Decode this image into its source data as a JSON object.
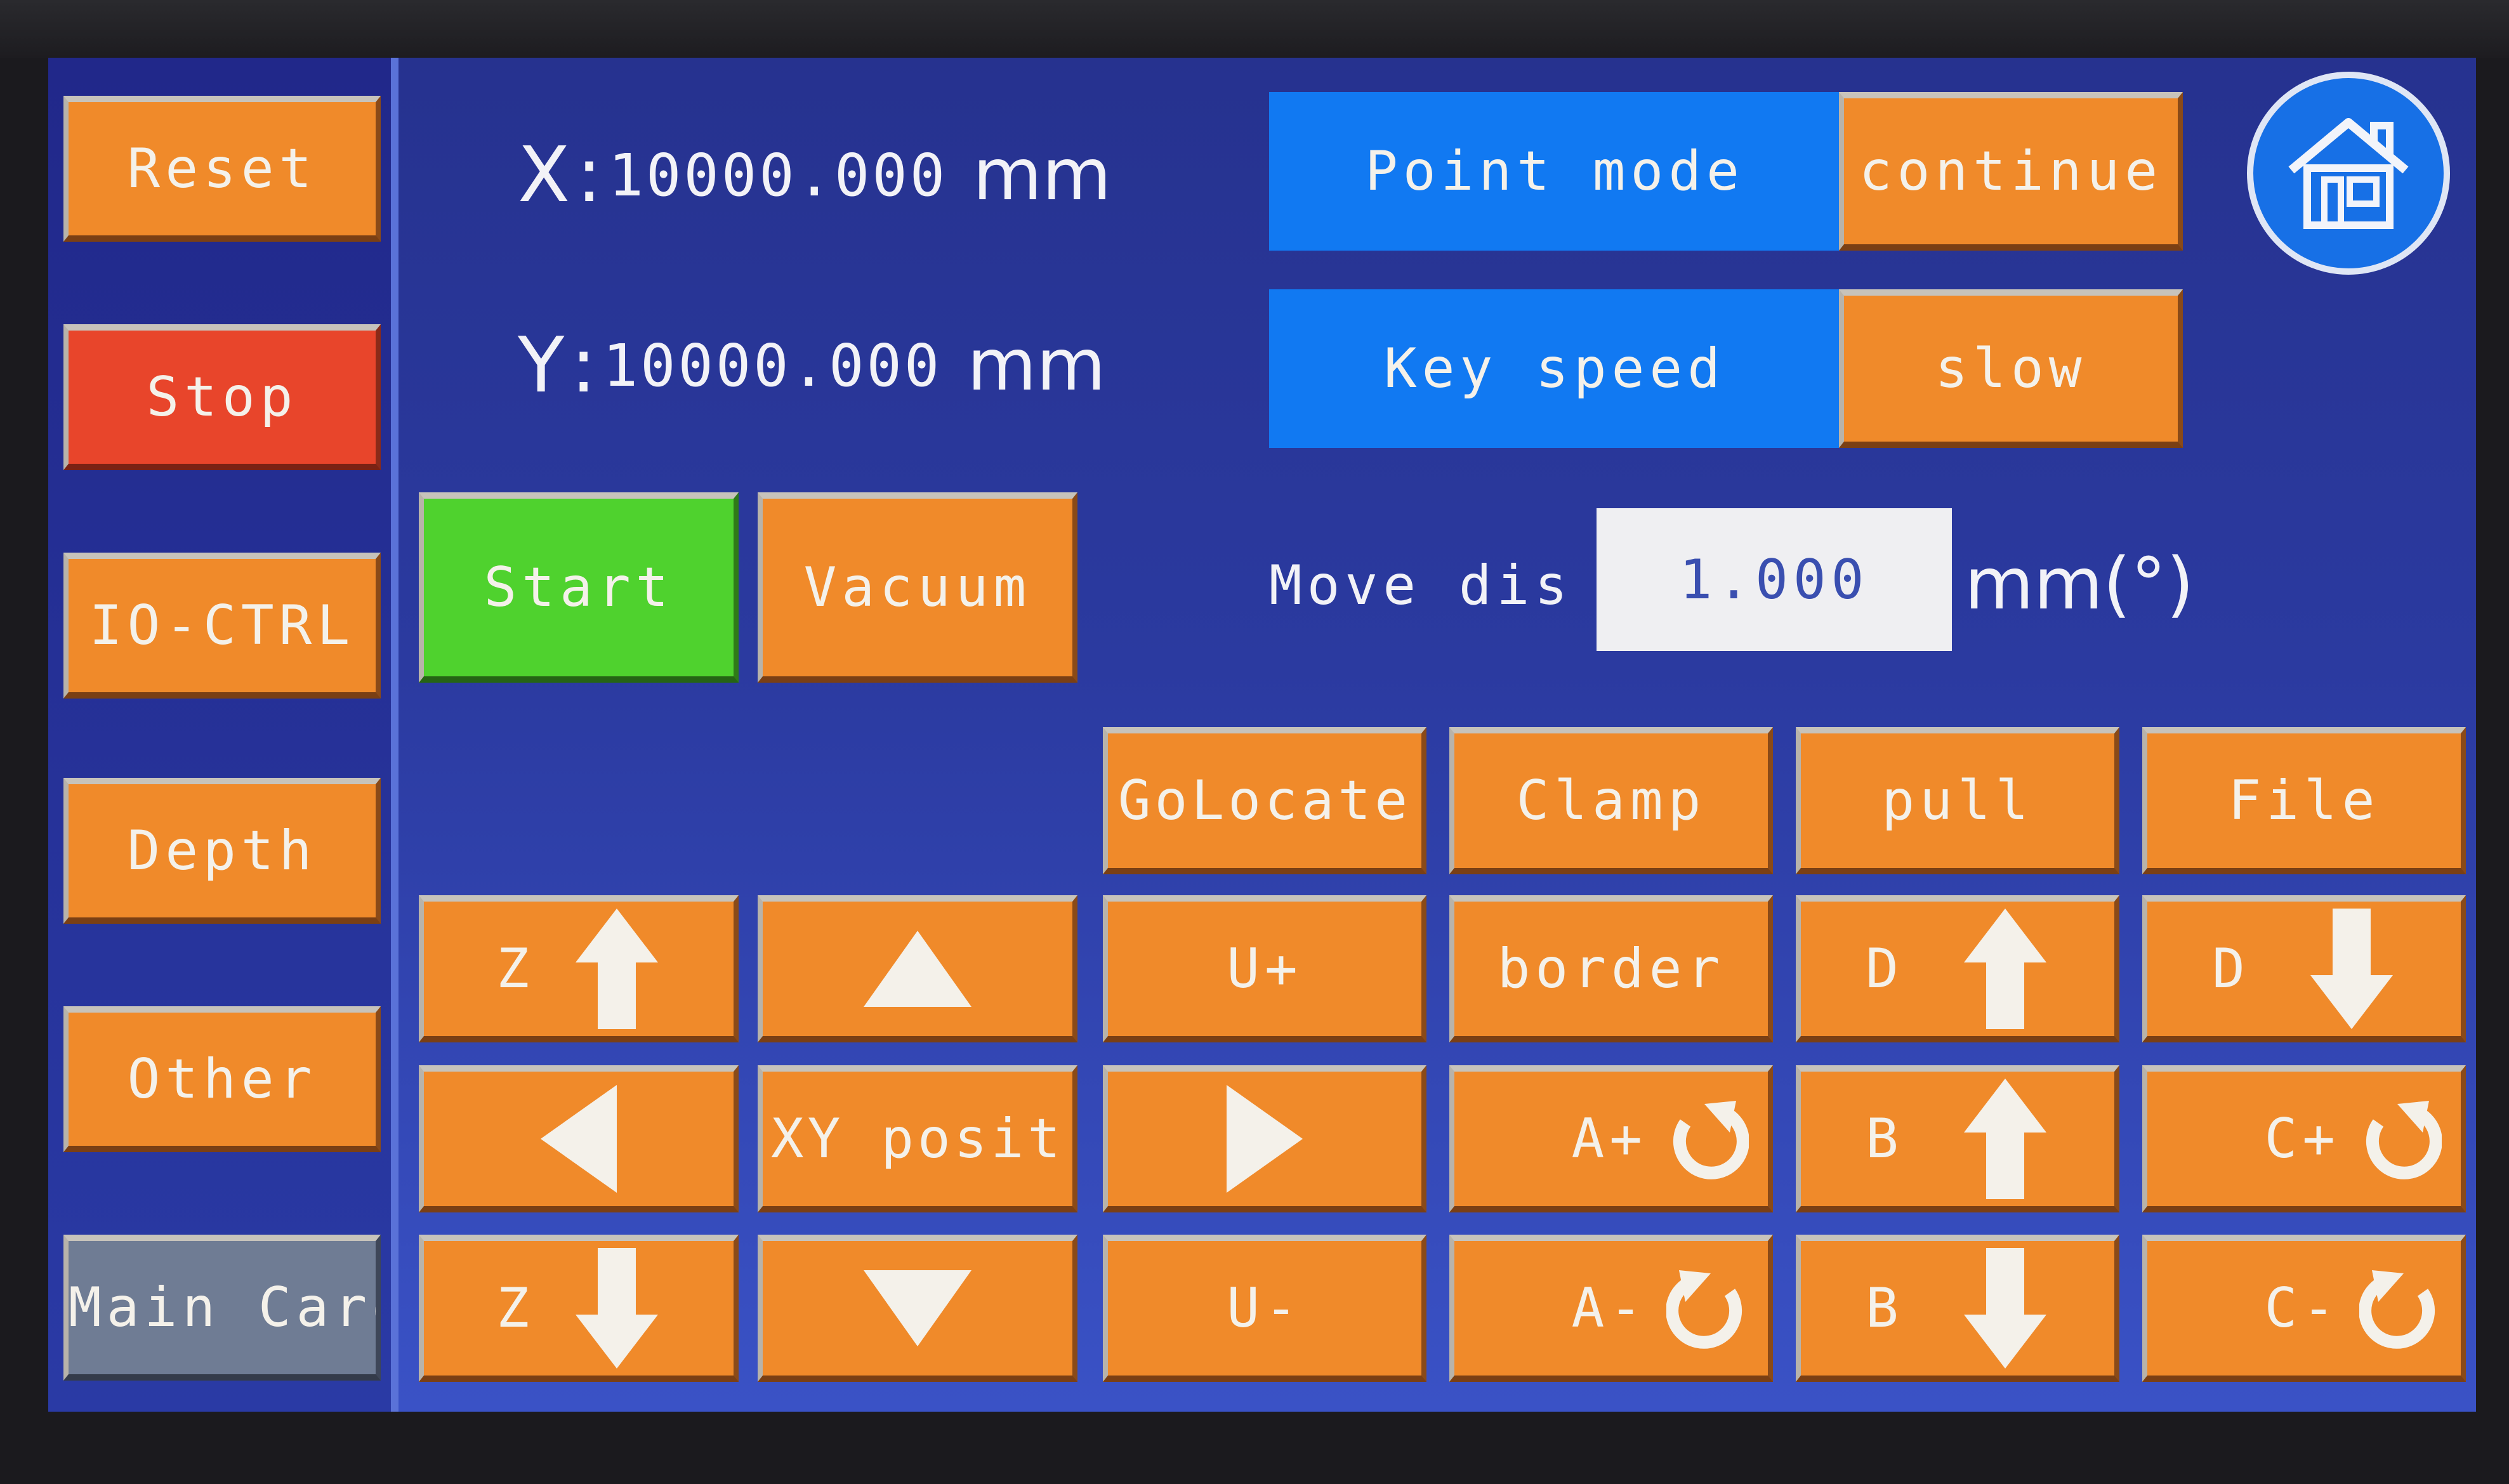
{
  "sidebar": {
    "reset": "Reset",
    "stop": "Stop",
    "io_ctrl": "IO-CTRL",
    "depth": "Depth",
    "other": "Other",
    "main_card": "Main Card"
  },
  "position": {
    "x_label": "X",
    "x_sep": ":",
    "x_value": "10000.000",
    "x_unit": "mm",
    "y_label": "Y",
    "y_sep": ":",
    "y_value": "10000.000",
    "y_unit": "mm"
  },
  "modes": {
    "point_mode_label": "Point mode",
    "point_mode_value": "continue",
    "key_speed_label": "Key speed",
    "key_speed_value": "slow"
  },
  "controls": {
    "start": "Start",
    "vacuum": "Vacuum",
    "move_dis_label": "Move dis",
    "move_dis_value": "1.000",
    "move_dis_unit": "mm(°)"
  },
  "grid": {
    "golocate": "GoLocate",
    "clamp": "Clamp",
    "pull": "pull",
    "file": "File",
    "z_up": "Z",
    "u_plus": "U+",
    "border": "border",
    "d_up": "D",
    "d_down": "D",
    "xy_posit": "XY posit",
    "a_plus": "A+",
    "b_up": "B",
    "c_plus": "C+",
    "z_down": "Z",
    "u_minus": "U-",
    "a_minus": "A-",
    "b_down": "B",
    "c_minus": "C-"
  },
  "icons": {
    "home": "home-icon",
    "arrow": "arrow-icon",
    "triangle": "triangle-icon",
    "rotate": "rotate-icon"
  },
  "colors": {
    "orange": "#f08a2a",
    "red": "#e8452b",
    "green": "#4fd22e",
    "blue": "#1179f2",
    "gray": "#6f7c94",
    "background": "#2b3aa0"
  }
}
